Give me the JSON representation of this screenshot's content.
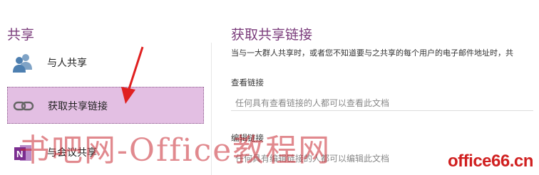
{
  "left": {
    "section_title": "共享",
    "items": [
      {
        "label": "与人共享",
        "icon": "people-icon"
      },
      {
        "label": "获取共享链接",
        "icon": "link-icon"
      },
      {
        "label": "与会议共享",
        "icon": "onenote-icon"
      }
    ]
  },
  "right": {
    "title": "获取共享链接",
    "description": "当与一大群人共享时，或者您不知道要与之共享的每个用户的电子邮件地址时，共",
    "view_label": "查看链接",
    "view_placeholder": "任何具有查看链接的人都可以查看此文档",
    "edit_label": "编辑链接",
    "edit_placeholder": "任何具有编辑链接的人都可以编辑此文档"
  },
  "watermark": "书吧网-Office教程网",
  "logo": "office66.cn",
  "colors": {
    "accent": "#7a3b7b",
    "selected_bg": "#e3bfe3",
    "arrow": "#e02020",
    "watermark": "#c82832"
  }
}
